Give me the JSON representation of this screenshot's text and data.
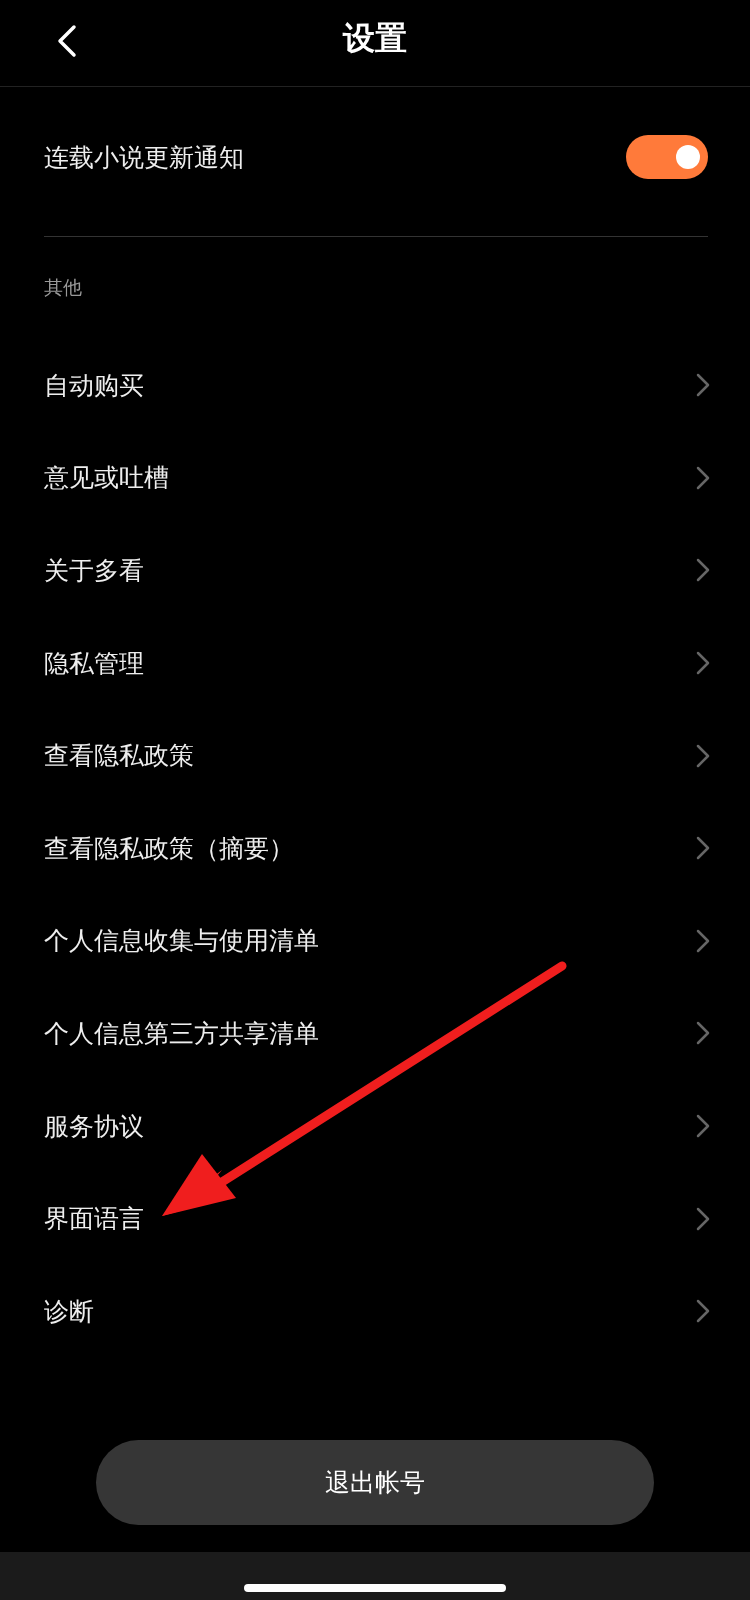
{
  "header": {
    "title": "设置"
  },
  "toggle_row": {
    "label": "连载小说更新通知",
    "on": true
  },
  "section": {
    "title": "其他"
  },
  "items": [
    {
      "label": "自动购买"
    },
    {
      "label": "意见或吐槽"
    },
    {
      "label": "关于多看"
    },
    {
      "label": "隐私管理"
    },
    {
      "label": "查看隐私政策"
    },
    {
      "label": "查看隐私政策（摘要）"
    },
    {
      "label": "个人信息收集与使用清单"
    },
    {
      "label": "个人信息第三方共享清单"
    },
    {
      "label": "服务协议"
    },
    {
      "label": "界面语言"
    },
    {
      "label": "诊断"
    }
  ],
  "logout_button": "退出帐号"
}
